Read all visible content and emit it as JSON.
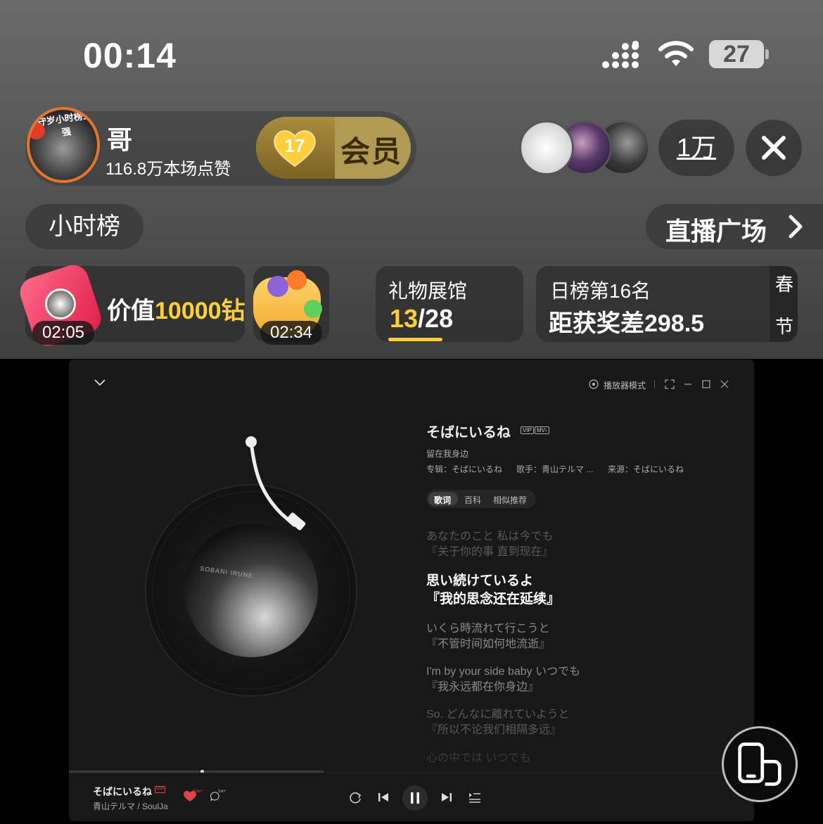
{
  "status_bar": {
    "time": "00:14",
    "battery": "27"
  },
  "host": {
    "name": "哥",
    "likes": "116.8万本场点赞",
    "badge_text": "守岁小时榜五强"
  },
  "vip": {
    "level": "17",
    "label": "会员"
  },
  "audience": {
    "count": "1万"
  },
  "rank_buttons": {
    "hour_rank": "小时榜",
    "plaza": "直播广场"
  },
  "gift_card": {
    "prefix": "价值",
    "amount": "10000",
    "suffix": "钻",
    "timer": "02:05"
  },
  "box_card": {
    "timer": "02:34"
  },
  "gift_hall": {
    "title": "礼物展馆",
    "current": "13",
    "total": "/28",
    "progress": 0.46
  },
  "daily_rank": {
    "title": "日榜第16名",
    "gap": "距获奖差298.5",
    "festival_1": "春",
    "festival_2": "节"
  },
  "player": {
    "mode_label": "播放器模式",
    "song": {
      "title": "そばにいるね",
      "vip_tag": "VIP",
      "mv_tag": "MV›",
      "subtitle": "留在我身边",
      "album": "专辑：そばにいるね",
      "singer": "歌手：青山テルマ ...",
      "source": "来源：そばにいるね"
    },
    "tabs": [
      "歌词",
      "百科",
      "相似推荐"
    ],
    "lyrics": [
      {
        "jp": "あなたのこと 私は今でも",
        "cn": "『关于你的事 直到现在』"
      },
      {
        "jp": "思い続けているよ",
        "cn": "『我的思念还在延续』"
      },
      {
        "jp": "いくら時流れて行こうと",
        "cn": "『不管时间如何地流逝』"
      },
      {
        "jp": "I'm by your side baby いつでも",
        "cn": "『我永远都在你身边』"
      },
      {
        "jp": "So. どんなに離れていようと",
        "cn": "『所以不论我们相隔多远』"
      },
      {
        "jp": "心の中では いつでも",
        "cn": ""
      }
    ],
    "cover_text": "SOBANI IRUNE",
    "now_playing": {
      "title": "そばにいるね",
      "vip_tag": "VIP",
      "artist": "青山テルマ / SoulJa",
      "like_count": "10w+",
      "comment_count": "1w+"
    }
  },
  "colors": {
    "accent_gold": "#ffcf3a",
    "like_red": "#e0424a",
    "player_bg": "#181818"
  }
}
